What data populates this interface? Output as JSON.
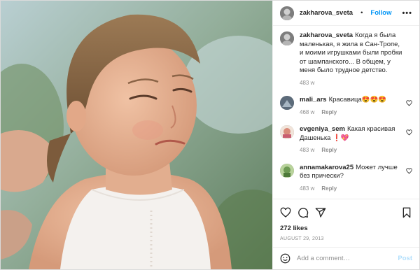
{
  "header": {
    "username": "zakharova_sveta",
    "separator": "•",
    "follow_label": "Follow",
    "more_label": "•••"
  },
  "caption": {
    "username": "zakharova_sveta",
    "text": "Когда я была маленькая, я жила в Сан-Тропе, и моими игрушками были пробки от шампанского... В общем, у меня было трудное детство.",
    "age": "483 w"
  },
  "comments": [
    {
      "username": "mali_ars",
      "text": "Красавица😍😍😍",
      "age": "468 w",
      "reply_label": "Reply",
      "avatar_color": "#5c6b7a"
    },
    {
      "username": "evgeniya_sem",
      "text": "Какая красивая Дашенька ❗️💖",
      "age": "483 w",
      "reply_label": "Reply",
      "avatar_color": "#e9d3c6"
    },
    {
      "username": "annamakarova25",
      "text": "Может лучше без прически?",
      "age": "483 w",
      "reply_label": "Reply",
      "avatar_color": "#6e9a54"
    }
  ],
  "actions": {
    "icons": [
      "heart-icon",
      "comment-icon",
      "share-icon",
      "bookmark-icon"
    ]
  },
  "likes": "272 likes",
  "date": "AUGUST 29, 2013",
  "add_comment": {
    "placeholder": "Add a comment…",
    "post_label": "Post"
  },
  "colors": {
    "accent": "#0095f6",
    "post_disabled": "#b2dffc",
    "muted": "#8e8e8e",
    "text": "#262626"
  }
}
